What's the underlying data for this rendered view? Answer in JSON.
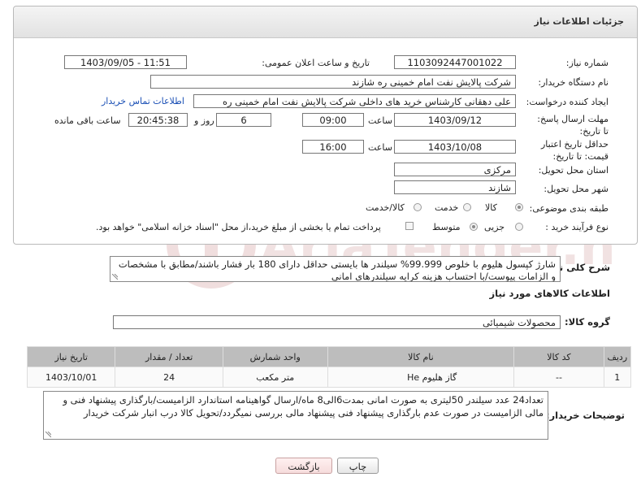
{
  "header": {
    "title": "جزئیات اطلاعات نیاز"
  },
  "need": {
    "number_label": "شماره نیاز:",
    "number": "1103092447001022",
    "announce_label": "تاریخ و ساعت اعلان عمومی:",
    "announce_value": "1403/09/05 - 11:51",
    "buyer_label": "نام دستگاه خریدار:",
    "buyer_value": "شرکت پالایش نفت امام خمینی  ره  شازند",
    "creator_label": "ایجاد کننده درخواست:",
    "creator_value": "علی دهقانی کارشناس خرید های داخلی  شرکت پالایش نفت امام خمینی  ره",
    "contact_link": "اطلاعات تماس خریدار",
    "deadline_label": "مهلت ارسال پاسخ: تا تاریخ:",
    "deadline_date": "1403/09/12",
    "time_label": "ساعت",
    "deadline_time": "09:00",
    "days_value": "6",
    "days_label": "روز و",
    "remaining_value": "20:45:38",
    "remaining_label": "ساعت باقی مانده",
    "validity_label": "حداقل تاریخ اعتبار قیمت: تا تاریخ:",
    "validity_date": "1403/10/08",
    "validity_time": "16:00",
    "province_label": "استان محل تحویل:",
    "province_value": "مرکزی",
    "city_label": "شهر محل تحویل:",
    "city_value": "شازند",
    "category_label": "طبقه بندی موضوعی:",
    "category_options": [
      "کالا",
      "خدمت",
      "کالا/خدمت"
    ],
    "process_label": "نوع فرآیند خرید :",
    "process_options": [
      "جزیی",
      "متوسط"
    ],
    "payment_note": "پرداخت تمام یا بخشی از مبلغ خرید،از محل \"اسناد خزانه اسلامی\" خواهد بود."
  },
  "description": {
    "label": "شرح کلی نیاز:",
    "text": "شارژ کپسول هلیوم با خلوص 99.999% سیلندر ها بایستی حداقل دارای 180 بار فشار باشند/مطابق با مشخصات و الزامات پیوست/با احتساب هزینه کرایه سیلندرهای امانی"
  },
  "goods": {
    "section_title": "اطلاعات کالاهای مورد نیاز",
    "group_label": "گروه کالا:",
    "group_value": "محصولات شیمیائی",
    "columns": [
      "ردیف",
      "کد کالا",
      "نام کالا",
      "واحد شمارش",
      "تعداد / مقدار",
      "تاریخ نیاز"
    ],
    "rows": [
      {
        "row": "1",
        "code": "--",
        "name": "گاز هلیوم He",
        "unit": "متر مکعب",
        "qty": "24",
        "date": "1403/10/01"
      }
    ]
  },
  "buyer_notes": {
    "label": "توضیحات خریدار:",
    "text": "تعداد24 عدد سیلندر 50لیتری به صورت امانی بمدت6الی8 ماه/ارسال گواهینامه استاندارد الزامیست/بارگذاری پیشنهاد فنی و مالی الزامیست در صورت عدم بارگذاری پیشنهاد فنی پیشنهاد مالی بررسی نمیگردد/تحویل کالا درب انبار شرکت خریدار"
  },
  "buttons": {
    "print": "چاپ",
    "back": "بازگشت"
  },
  "watermark": {
    "text": "AriaTender.neT",
    "color": "#e9d3d3"
  }
}
